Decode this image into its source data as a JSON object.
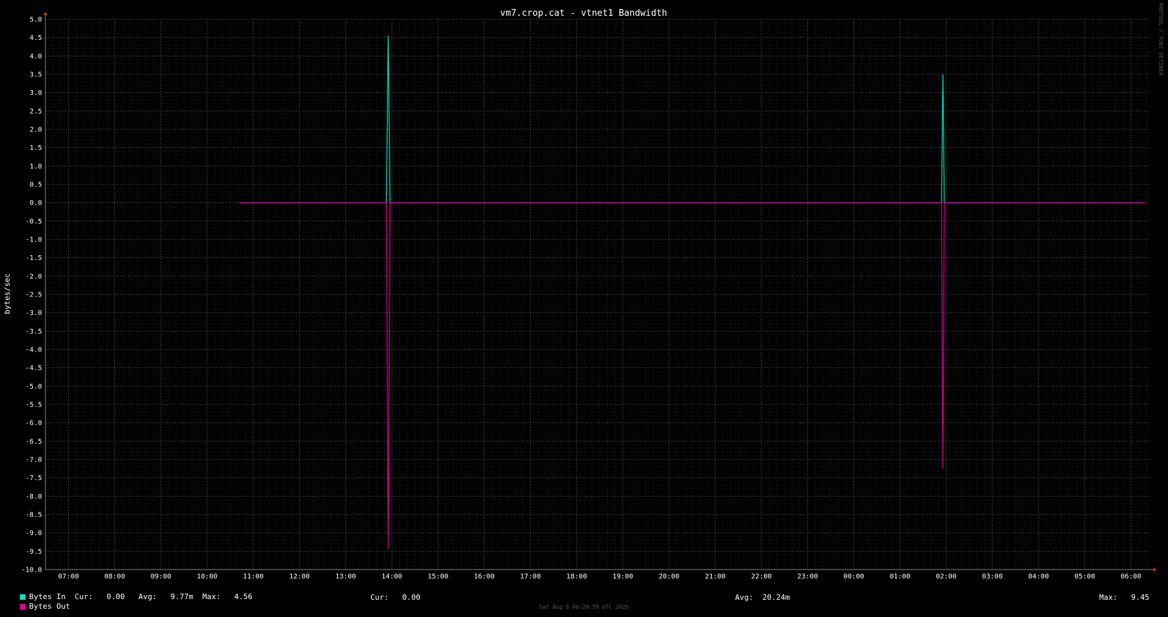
{
  "chart_data": {
    "type": "line",
    "title": "vm7.crop.cat - vtnet1 Bandwidth",
    "ylabel": "bytes/sec",
    "ylim": [
      -10.0,
      5.0
    ],
    "y_ticks": [
      "5.0",
      "4.5",
      "4.0",
      "3.5",
      "3.0",
      "2.5",
      "2.0",
      "1.5",
      "1.0",
      "0.5",
      "0.0",
      "-0.5",
      "-1.0",
      "-1.5",
      "-2.0",
      "-2.5",
      "-3.0",
      "-3.5",
      "-4.0",
      "-4.5",
      "-5.0",
      "-5.5",
      "-6.0",
      "-6.5",
      "-7.0",
      "-7.5",
      "-8.0",
      "-8.5",
      "-9.0",
      "-9.5",
      "-10.0"
    ],
    "x_ticks": [
      "07:00",
      "08:00",
      "09:00",
      "10:00",
      "11:00",
      "12:00",
      "13:00",
      "14:00",
      "15:00",
      "16:00",
      "17:00",
      "18:00",
      "19:00",
      "20:00",
      "21:00",
      "22:00",
      "23:00",
      "00:00",
      "01:00",
      "02:00",
      "03:00",
      "04:00",
      "05:00",
      "06:00"
    ],
    "x_range_hours": [
      6.5,
      30.4
    ],
    "grid": true,
    "series": [
      {
        "name": "Bytes In",
        "color": "#00e6c8",
        "points": [
          [
            10.7,
            0.0
          ],
          [
            13.88,
            0.0
          ],
          [
            13.92,
            4.56
          ],
          [
            13.96,
            0.0
          ],
          [
            25.9,
            0.0
          ],
          [
            25.93,
            3.5
          ],
          [
            25.96,
            0.0
          ],
          [
            30.3,
            0.0
          ]
        ]
      },
      {
        "name": "Bytes Out",
        "color": "#e0009a",
        "points": [
          [
            10.7,
            0.0
          ],
          [
            13.88,
            0.0
          ],
          [
            13.92,
            -9.45
          ],
          [
            13.96,
            0.0
          ],
          [
            25.9,
            0.0
          ],
          [
            25.93,
            -7.25
          ],
          [
            25.96,
            0.0
          ],
          [
            30.3,
            0.0
          ]
        ]
      }
    ]
  },
  "legend": {
    "bytes_in": {
      "label": "Bytes In",
      "color": "#00e6c8",
      "cur": "Cur:   0.00",
      "avg": "Avg:   9.77m",
      "max": "Max:   4.56"
    },
    "bytes_out": {
      "label": "Bytes Out",
      "color": "#e0009a",
      "cur": "Cur:   0.00",
      "avg": "Avg:  20.24m",
      "max": "Max:   9.45"
    }
  },
  "footer": "Sat Aug  8 06:20:59 UTC 2026",
  "watermark": "RRDTOOL / TOBI OETIKER"
}
